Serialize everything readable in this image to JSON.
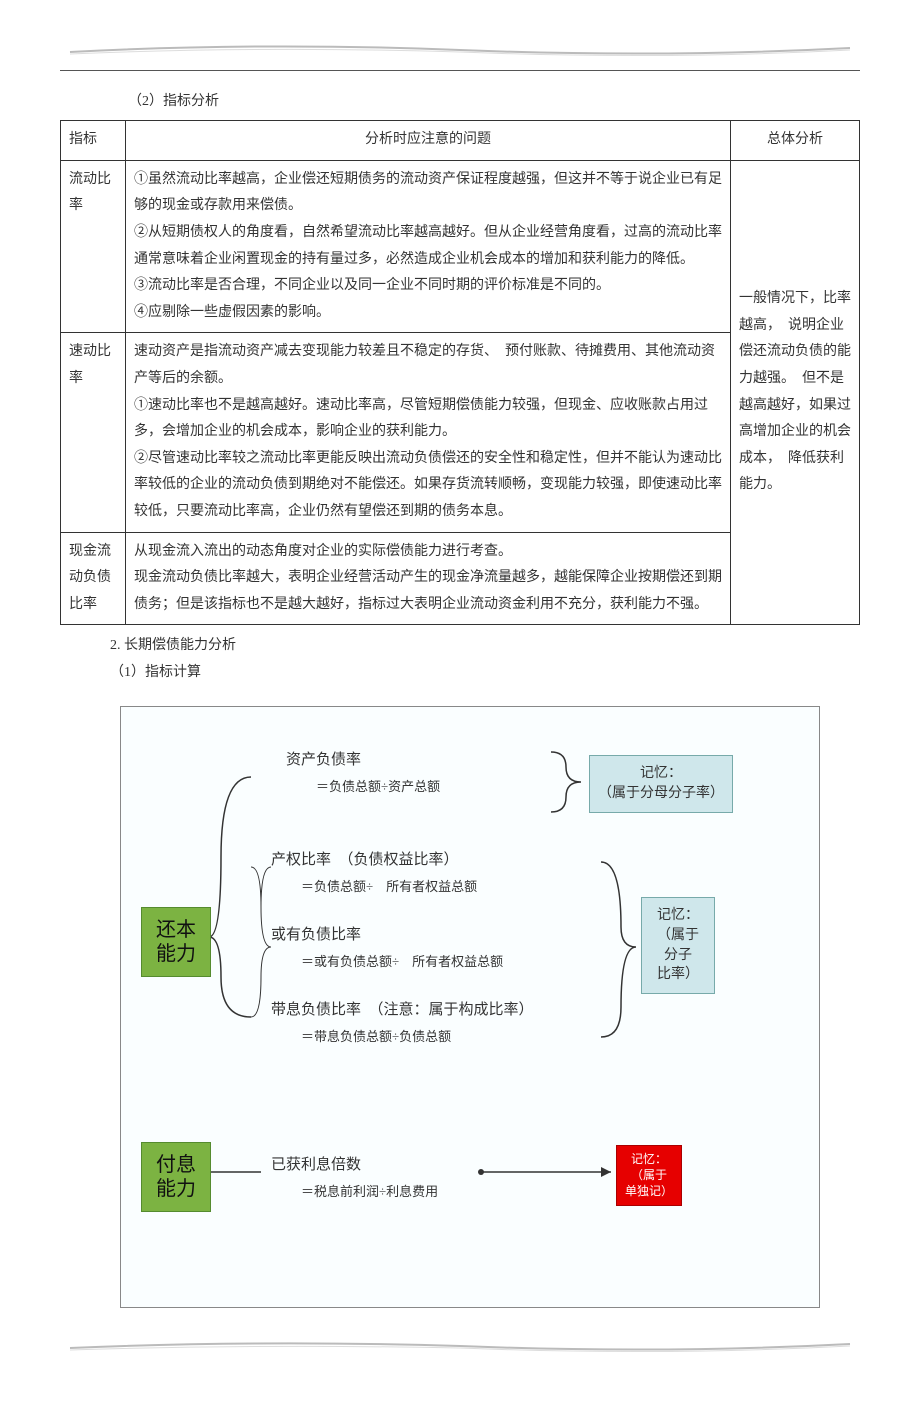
{
  "section_title": "（2）指标分析",
  "table": {
    "headers": [
      "指标",
      "分析时应注意的问题",
      "总体分析"
    ],
    "rows": [
      {
        "indicator": "流动比率",
        "analysis": "①虽然流动比率越高，企业偿还短期债务的流动资产保证程度越强，但这并不等于说企业已有足够的现金或存款用来偿债。\n②从短期债权人的角度看，自然希望流动比率越高越好。但从企业经营角度看，过高的流动比率通常意味着企业闲置现金的持有量过多，必然造成企业机会成本的增加和获利能力的降低。\n③流动比率是否合理，不同企业以及同一企业不同时期的评价标准是不同的。\n④应剔除一些虚假因素的影响。"
      },
      {
        "indicator": "速动比率",
        "analysis": "速动资产是指流动资产减去变现能力较差且不稳定的存货、　预付账款、待摊费用、其他流动资产等后的余额。\n①速动比率也不是越高越好。速动比率高，尽管短期偿债能力较强，但现金、应收账款占用过多，会增加企业的机会成本，影响企业的获利能力。\n②尽管速动比率较之流动比率更能反映出流动负债偿还的安全性和稳定性，但并不能认为速动比率较低的企业的流动负债到期绝对不能偿还。如果存货流转顺畅，变现能力较强，即使速动比率较低，只要流动比率高，企业仍然有望偿还到期的债务本息。"
      },
      {
        "indicator": "现金流动负债比率",
        "analysis": "从现金流入流出的动态角度对企业的实际偿债能力进行考查。\n现金流动负债比率越大，表明企业经营活动产生的现金净流量越多，越能保障企业按期偿还到期债务；但是该指标也不是越大越好，指标过大表明企业流动资金利用不充分，获利能力不强。",
        "summary": "一般情况下，比率越高，　说明企业偿还流动负债的能力越强。　但不是越高越好，如果过高增加企业的机会成本，　降低获利能力。"
      }
    ]
  },
  "section2_title": "2. 长期偿债能力分析",
  "section2_sub": "（1）指标计算",
  "diagram": {
    "root1": "还本能力",
    "root2": "付息能力",
    "f1_title": "资产负债率",
    "f1_formula": "＝负债总额÷资产总额",
    "f2_title": "产权比率　（负债权益比率）",
    "f2_formula": "＝负债总额÷　所有者权益总额",
    "f3_title": "或有负债比率",
    "f3_formula": "＝或有负债总额÷　所有者权益总额",
    "f4_title": "带息负债比率　（注意：属于构成比率）",
    "f4_formula": "＝带息负债总额÷负债总额",
    "f5_title": "已获利息倍数",
    "f5_formula": "＝税息前利润÷利息费用",
    "memo1": "记忆：\n（属于分母分子率）",
    "memo2": "记忆：\n（属于\n分子\n比率）",
    "memo3": "记忆：\n（属于\n单独记）"
  }
}
